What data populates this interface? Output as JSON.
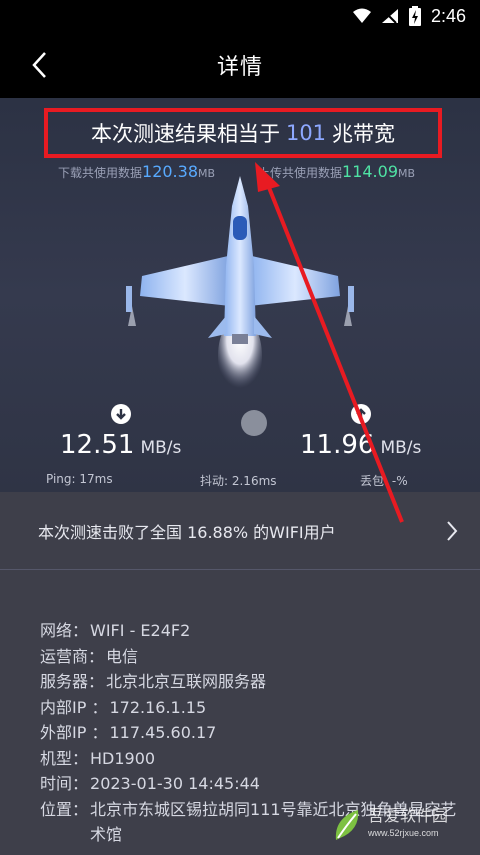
{
  "status_bar": {
    "time": "2:46"
  },
  "header": {
    "title": "详情"
  },
  "summary": {
    "prefix": "本次测速结果相当于",
    "value": "101",
    "suffix": "兆带宽"
  },
  "download_data": {
    "label": "下载共使用数据",
    "value": "120.38",
    "unit": "MB"
  },
  "upload_data": {
    "label": "上传共使用数据",
    "value": "114.09",
    "unit": "MB"
  },
  "download": {
    "speed": "12.51",
    "unit": "MB/s"
  },
  "upload": {
    "speed": "11.96",
    "unit": "MB/s"
  },
  "metrics": {
    "ping": "Ping: 17ms",
    "jitter": "抖动: 2.16ms",
    "loss": "丢包: -%"
  },
  "defeat": {
    "text": "本次测速击败了全国 16.88% 的WIFI用户"
  },
  "info": [
    {
      "label": "网络：",
      "value": "WIFI - E24F2"
    },
    {
      "label": "运营商：",
      "value": "电信"
    },
    {
      "label": "服务器：",
      "value": "北京北京互联网服务器"
    },
    {
      "label": "内部IP ：",
      "value": "172.16.1.15"
    },
    {
      "label": "外部IP ：",
      "value": "117.45.60.17"
    },
    {
      "label": "机型：",
      "value": "HD1900"
    },
    {
      "label": "时间：",
      "value": "2023-01-30 14:45:44"
    },
    {
      "label": "位置：",
      "value": "北京市东城区锡拉胡同111号靠近北京独角兽星空艺术馆"
    }
  ],
  "watermark": {
    "text": "吾爱软件园",
    "url": "www.52rjxue.com"
  },
  "colors": {
    "accent_blue": "#58aaff",
    "accent_green": "#4fe3a4",
    "highlight_red": "#e81b22"
  }
}
